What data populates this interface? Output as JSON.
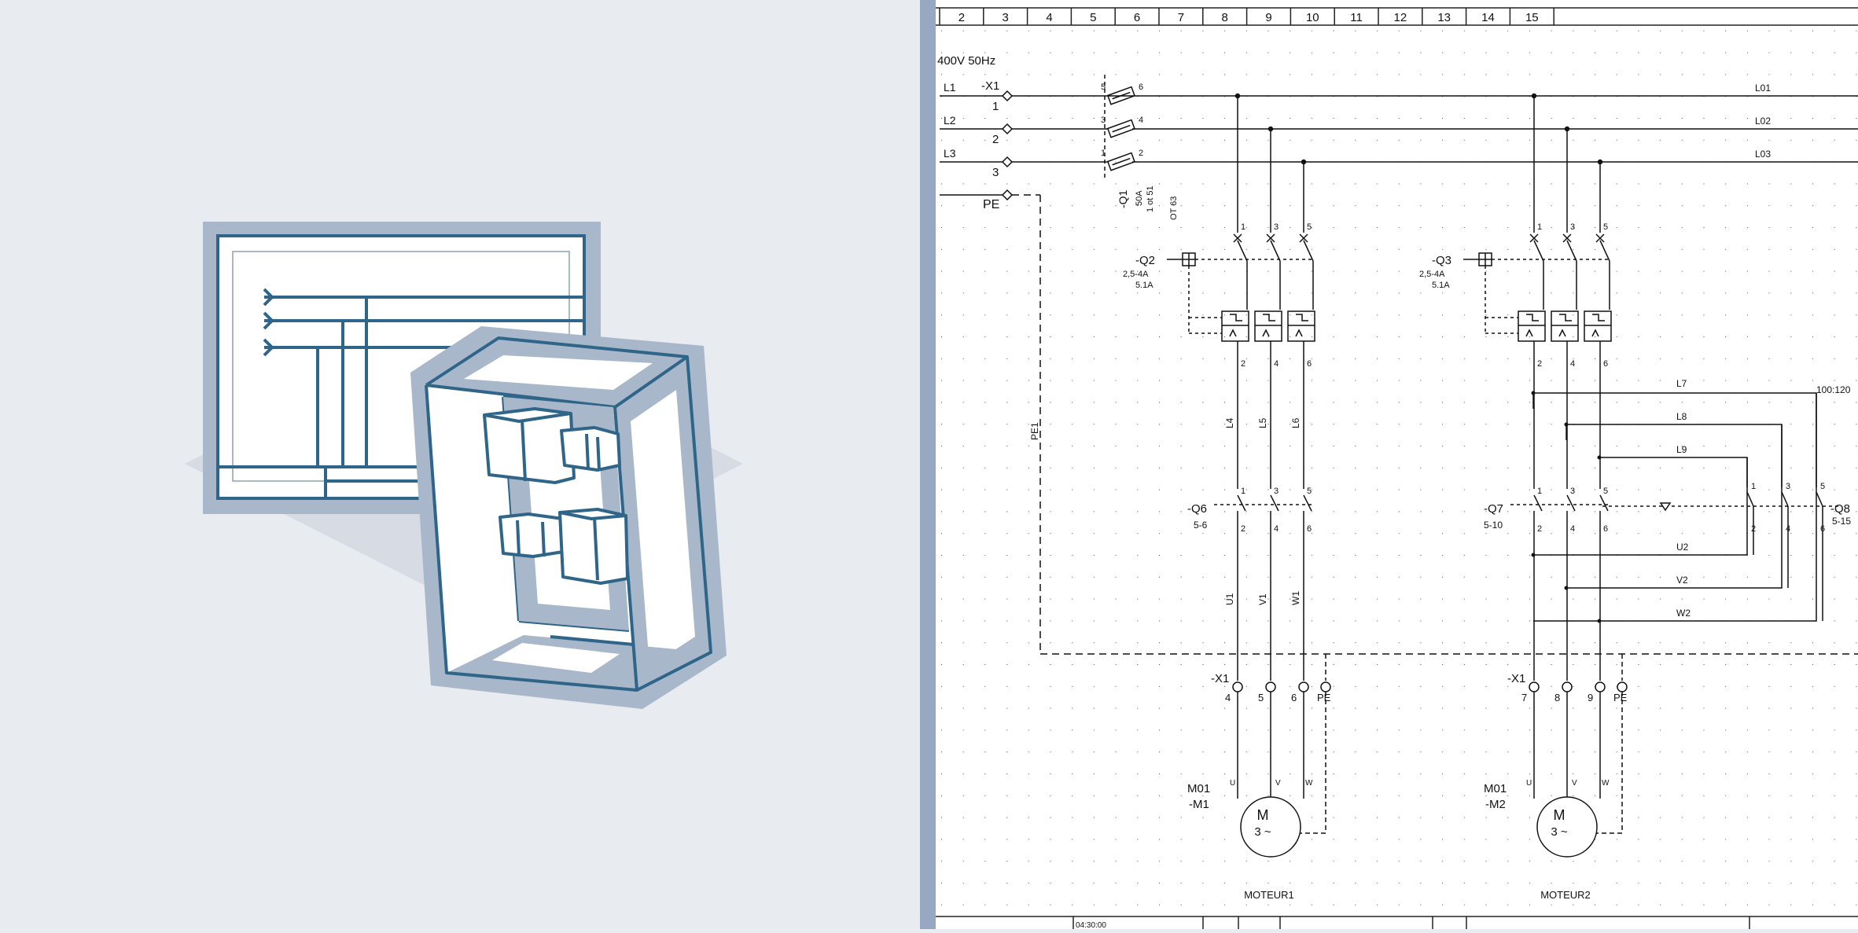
{
  "illustration": {
    "icon": "cabinet-schematic-icon",
    "colors": {
      "frame": "#a9b7cb",
      "stroke": "#2f6588",
      "fill": "#ffffff",
      "background": "#e8ebf0"
    }
  },
  "schematic": {
    "column_numbers": [
      "2",
      "3",
      "4",
      "5",
      "6",
      "7",
      "8",
      "9",
      "10",
      "11",
      "12",
      "13",
      "14",
      "15"
    ],
    "supply_label": "400V 50Hz",
    "lines": {
      "l1": "L1",
      "l2": "L2",
      "l3": "L3",
      "pe": "PE"
    },
    "terminal_x1": {
      "tag": "-X1",
      "t1": "1",
      "t2": "2",
      "t3": "3"
    },
    "main_switch": {
      "tag": "-Q1",
      "rating": "50A",
      "poles": "1 ot 51",
      "type": "OT 63",
      "pins": [
        "5",
        "6",
        "3",
        "4",
        "1",
        "2"
      ]
    },
    "right_bus": {
      "l01": "L01",
      "l02": "L02",
      "l03": "L03"
    },
    "pe_wire": "PE1",
    "breaker_q2": {
      "tag": "-Q2",
      "range": "2,5-4A",
      "setting": "5.1A",
      "pins_top": [
        "1",
        "3",
        "5"
      ],
      "pins_bottom": [
        "2",
        "4",
        "6"
      ]
    },
    "breaker_q3": {
      "tag": "-Q3",
      "range": "2,5-4A",
      "setting": "5.1A",
      "pins_top": [
        "1",
        "3",
        "5"
      ],
      "pins_bottom": [
        "2",
        "4",
        "6"
      ]
    },
    "wires_m1": [
      "L4",
      "L5",
      "L6"
    ],
    "contactor_q6": {
      "tag": "-Q6",
      "ref": "5-6",
      "pins_top": [
        "1",
        "3",
        "5"
      ],
      "pins_bottom": [
        "2",
        "4",
        "6"
      ]
    },
    "contactor_q7": {
      "tag": "-Q7",
      "ref": "5-10",
      "pins_top": [
        "1",
        "3",
        "5"
      ],
      "pins_bottom": [
        "2",
        "4",
        "6"
      ]
    },
    "contactor_q8": {
      "tag": "-Q8",
      "ref": "5-15",
      "pins_top": [
        "1",
        "3",
        "5"
      ],
      "pins_bottom": [
        "2",
        "4",
        "6"
      ]
    },
    "delta_wires": {
      "l7": "L7",
      "l8": "L8",
      "l9": "L9",
      "u2": "U2",
      "v2": "V2",
      "w2": "W2",
      "ref": "100:120"
    },
    "outputs_m1": [
      "U1",
      "V1",
      "W1"
    ],
    "terminals_m1": {
      "tag": "-X1",
      "t": [
        "4",
        "5",
        "6"
      ],
      "pe": "PE"
    },
    "terminals_m2": {
      "tag": "-X1",
      "t": [
        "7",
        "8",
        "9"
      ],
      "pe": "PE"
    },
    "motor1": {
      "ref": "M01",
      "tag": "-M1",
      "symbol": "M",
      "phase": "3 ~",
      "uvw": [
        "U",
        "V",
        "W"
      ],
      "name": "MOTEUR1"
    },
    "motor2": {
      "ref": "M01",
      "tag": "-M2",
      "symbol": "M",
      "phase": "3 ~",
      "uvw": [
        "U",
        "V",
        "W"
      ],
      "name": "MOTEUR2"
    },
    "footer_stamp": "04:30:00"
  }
}
